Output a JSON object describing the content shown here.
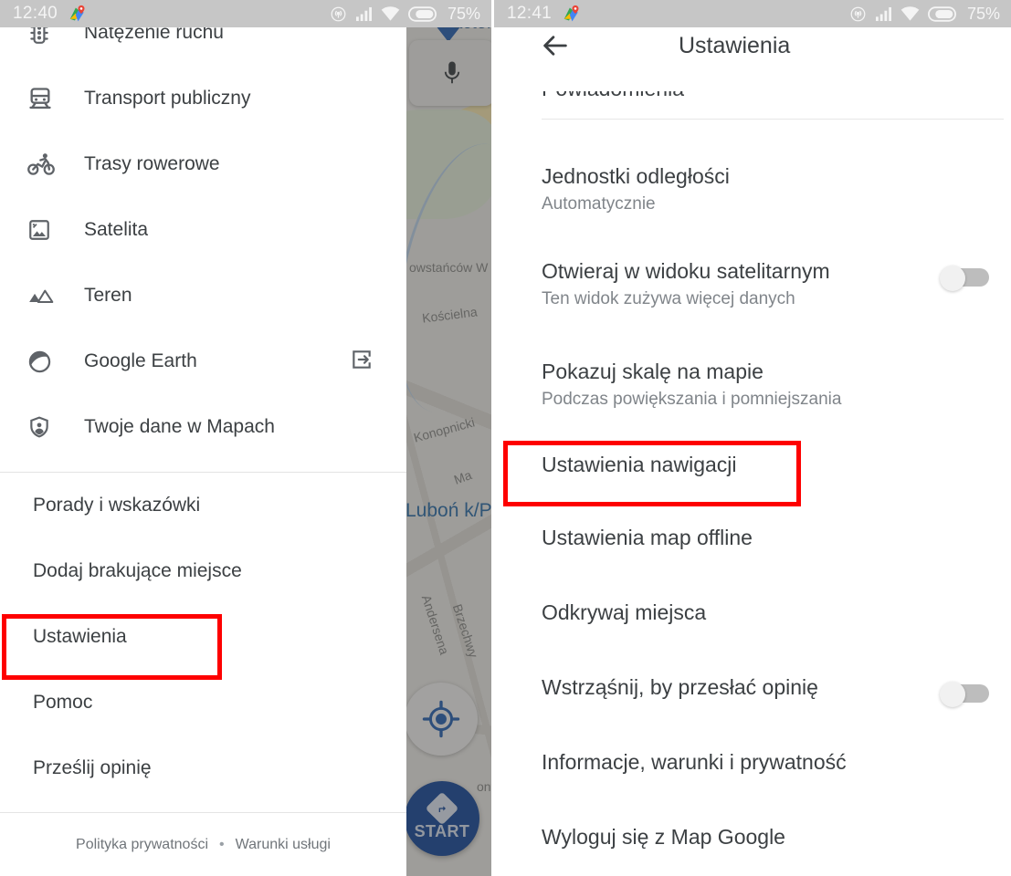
{
  "left_screen": {
    "status_bar": {
      "clock": "12:40",
      "battery_pct": "75%",
      "icons": [
        "maps-badge-icon",
        "hotspot-icon",
        "signal-bars-icon",
        "wifi-icon",
        "battery-icon"
      ]
    },
    "drawer": {
      "items": [
        {
          "label": "Natężenie ruchu",
          "icon": "traffic-light-icon"
        },
        {
          "label": "Transport publiczny",
          "icon": "train-icon"
        },
        {
          "label": "Trasy rowerowe",
          "icon": "bicycle-icon"
        },
        {
          "label": "Satelita",
          "icon": "satellite-image-icon"
        },
        {
          "label": "Teren",
          "icon": "terrain-mountains-icon"
        },
        {
          "label": "Google Earth",
          "icon": "google-earth-icon",
          "trailing_icon": "open-external-icon"
        },
        {
          "label": "Twoje dane w Mapach",
          "icon": "shield-person-icon"
        }
      ],
      "secondary_items": [
        {
          "label": "Porady i wskazówki"
        },
        {
          "label": "Dodaj brakujące miejsce"
        },
        {
          "label": "Ustawienia",
          "highlighted": true
        },
        {
          "label": "Pomoc"
        },
        {
          "label": "Prześlij opinię"
        }
      ],
      "footer": {
        "privacy": "Polityka prywatności",
        "separator": "•",
        "terms": "Warunki usługi"
      }
    },
    "map": {
      "labels": [
        {
          "text": "Factor",
          "kind": "poi"
        },
        {
          "text": "owstańców W",
          "kind": "street"
        },
        {
          "text": "Kościelna",
          "kind": "street"
        },
        {
          "text": "Konopnicki",
          "kind": "street"
        },
        {
          "text": "Ma",
          "kind": "street"
        },
        {
          "text": "Luboń k/P",
          "kind": "city"
        },
        {
          "text": "Andersena",
          "kind": "street"
        },
        {
          "text": "Brzechwy",
          "kind": "street"
        },
        {
          "text": "onta",
          "kind": "street"
        }
      ],
      "buttons": {
        "mic": "microphone-icon",
        "locate": "my-location-icon",
        "start_label": "START",
        "start_icon": "navigation-arrow-icon"
      }
    }
  },
  "right_screen": {
    "status_bar": {
      "clock": "12:41",
      "battery_pct": "75%",
      "icons": [
        "maps-badge-icon",
        "hotspot-icon",
        "signal-bars-icon",
        "wifi-icon",
        "battery-icon"
      ]
    },
    "appbar": {
      "back_icon": "back-arrow-icon",
      "title": "Ustawienia"
    },
    "partial_top_row": "Powiadomienia",
    "rows": [
      {
        "title": "Jednostki odległości",
        "subtitle": "Automatycznie",
        "toggle": null
      },
      {
        "title": "Otwieraj w widoku satelitarnym",
        "subtitle": "Ten widok zużywa więcej danych",
        "toggle": "off"
      },
      {
        "title": "Pokazuj skalę na mapie",
        "subtitle": "Podczas powiększania i pomniejszania",
        "toggle": null
      },
      {
        "title": "Ustawienia nawigacji",
        "subtitle": "",
        "toggle": null,
        "highlighted": true
      },
      {
        "title": "Ustawienia map offline",
        "subtitle": "",
        "toggle": null
      },
      {
        "title": "Odkrywaj miejsca",
        "subtitle": "",
        "toggle": null
      },
      {
        "title": "Wstrząśnij, by przesłać opinię",
        "subtitle": "",
        "toggle": "off"
      },
      {
        "title": "Informacje, warunki i prywatność",
        "subtitle": "",
        "toggle": null
      },
      {
        "title": "Wyloguj się z Map Google",
        "subtitle": "",
        "toggle": null
      }
    ]
  },
  "annotations": {
    "highlight_color": "#fe0000",
    "boxes": [
      {
        "target": "Ustawienia"
      },
      {
        "target": "Ustawienia nawigacji"
      }
    ]
  }
}
